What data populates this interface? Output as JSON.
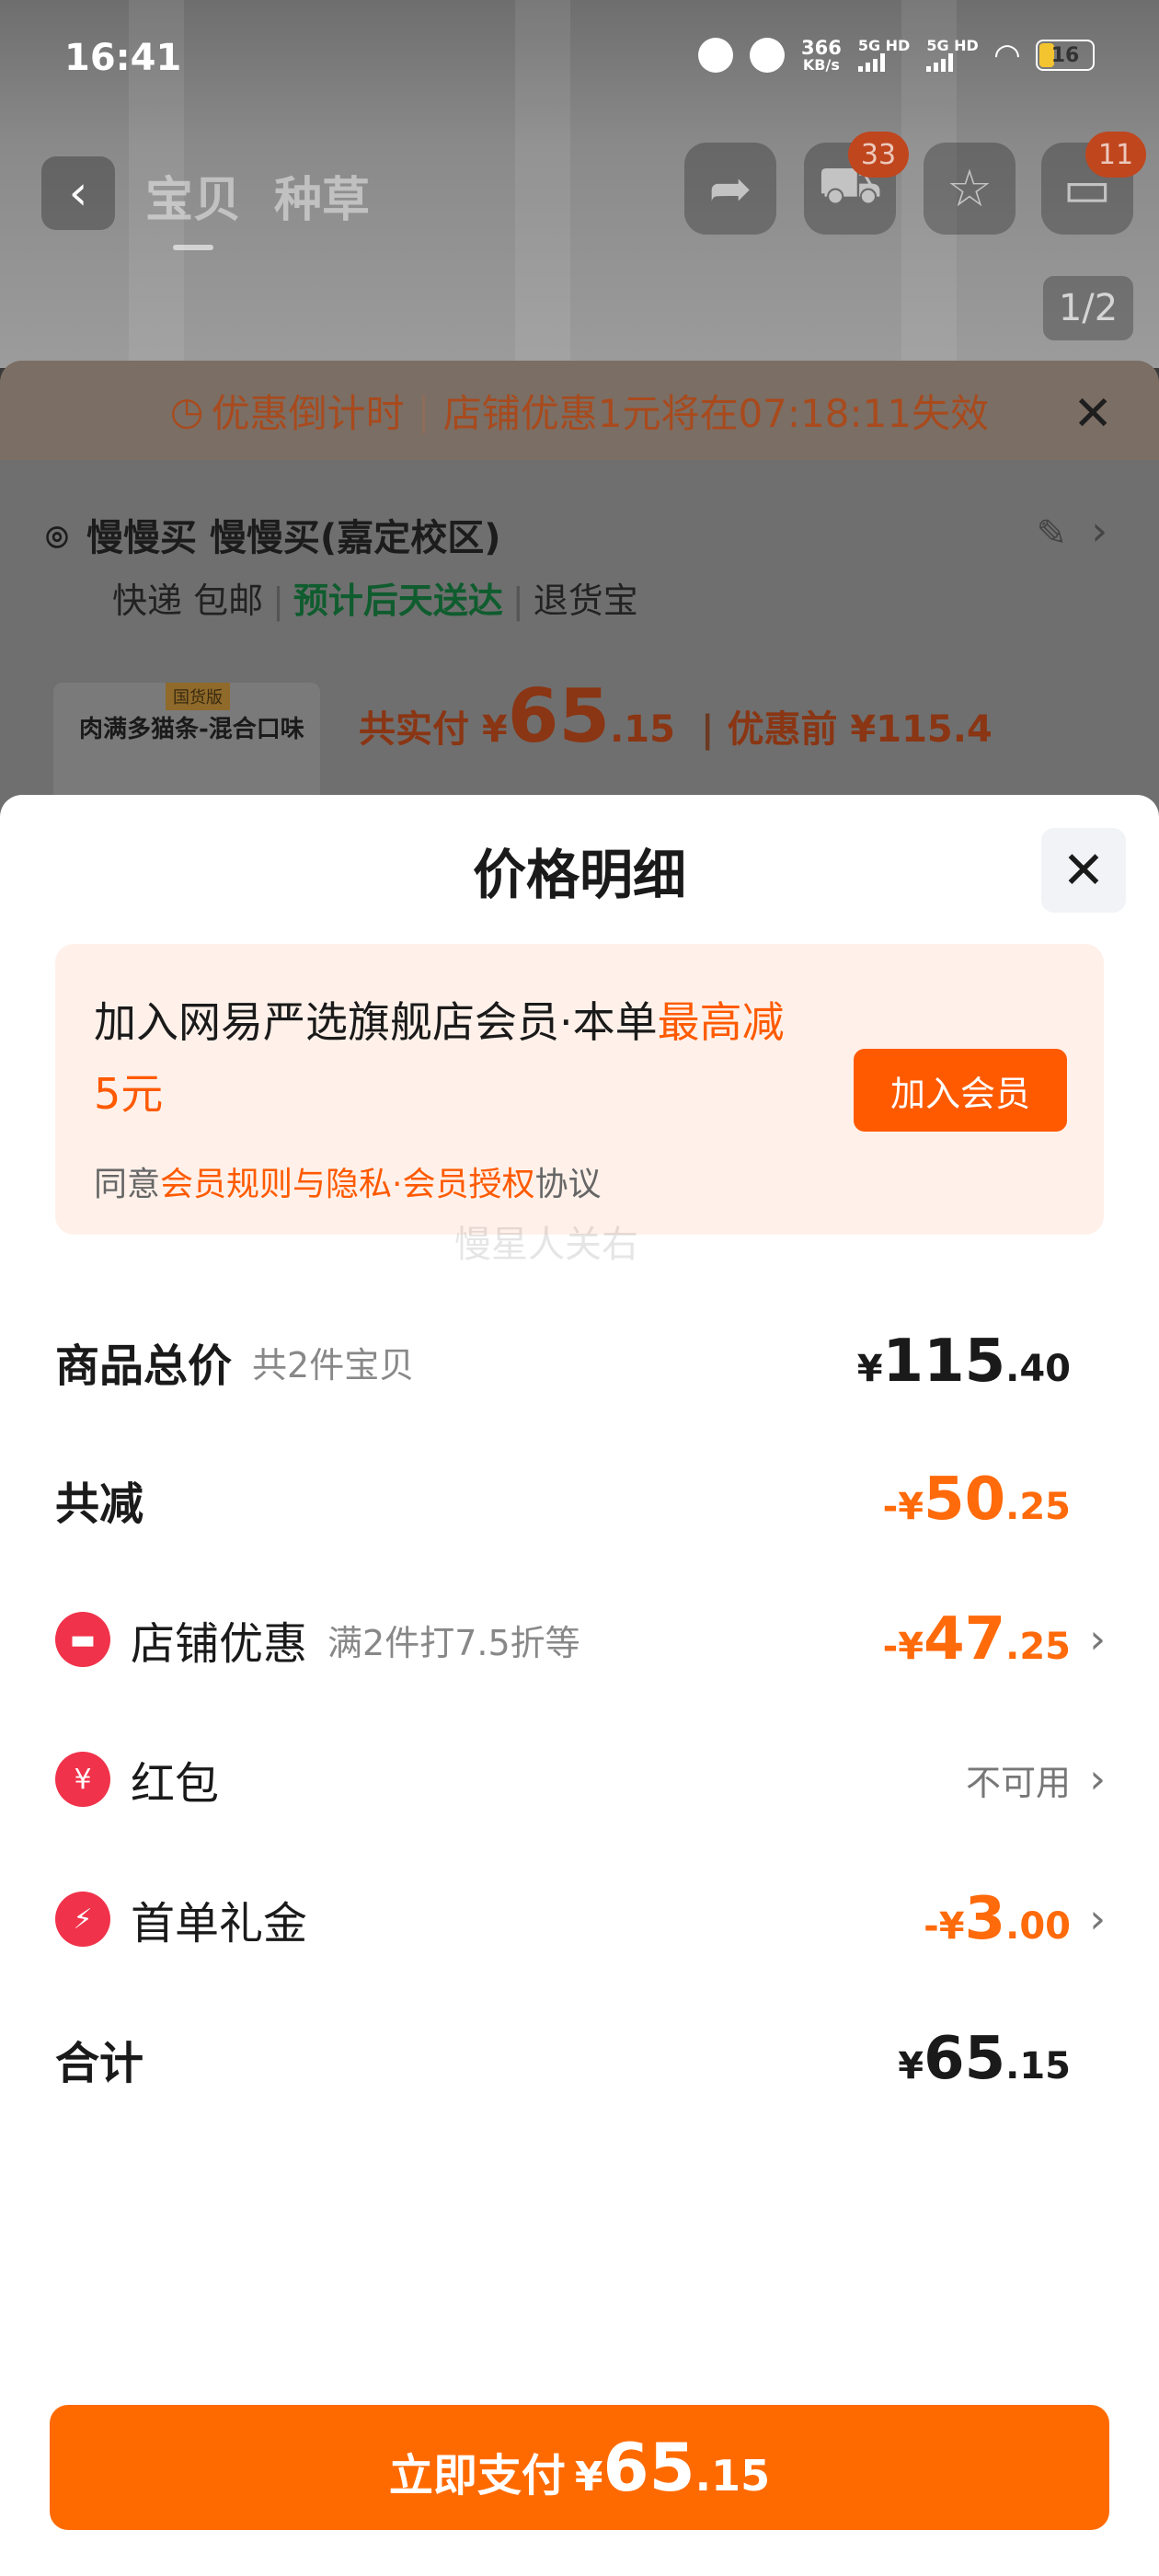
{
  "status": {
    "time": "16:41",
    "speed_value": "366",
    "speed_unit": "KB/s",
    "sim1": "5G HD",
    "sim2": "5G HD",
    "battery": "16"
  },
  "nav": {
    "tab_baobei": "宝贝",
    "tab_zhongcao": "种草",
    "cart_badge": "33",
    "msg_badge": "11",
    "image_counter": "1/2"
  },
  "background": {
    "countdown_label": "优惠倒计时",
    "countdown_text": "店铺优惠1元将在07:18:11失效",
    "address": "慢慢买 慢慢买(嘉定校区)",
    "delivery": "快递 包邮",
    "eta": "预计后天送达",
    "returns": "退货宝",
    "product_tag": "国货版",
    "product_name": "肉满多猫条-混合口味",
    "price_prefix": "共实付 ¥",
    "price_int": "65",
    "price_dec": ".15",
    "price_before": "优惠前 ¥115.4"
  },
  "sheet": {
    "title": "价格明细",
    "watermark": "慢星人关右",
    "member": {
      "text_main": "加入网易严选旗舰店会员·本单",
      "text_highlight": "最高减5元",
      "button": "加入会员",
      "agree_prefix": "同意",
      "agree_link": "会员规则与隐私·会员授权",
      "agree_suffix": "协议"
    },
    "rows": {
      "total": {
        "label": "商品总价",
        "sub": "共2件宝贝",
        "cur": "¥",
        "int": "115",
        "dec": ".40"
      },
      "reduce": {
        "label": "共减",
        "cur": "-¥",
        "int": "50",
        "dec": ".25"
      },
      "shop": {
        "label": "店铺优惠",
        "sub": "满2件打7.5折等",
        "cur": "-¥",
        "int": "47",
        "dec": ".25"
      },
      "redpacket": {
        "label": "红包",
        "value": "不可用"
      },
      "firstorder": {
        "label": "首单礼金",
        "cur": "-¥",
        "int": "3",
        "dec": ".00"
      },
      "sum": {
        "label": "合计",
        "cur": "¥",
        "int": "65",
        "dec": ".15"
      }
    },
    "pay": {
      "label": "立即支付",
      "cur": "¥",
      "int": "65",
      "dec": ".15"
    }
  },
  "colors": {
    "accent": "#ff6a00",
    "discount": "#ff6a0a",
    "icon_red": "#f0324a",
    "member_bg": "#fff1ea"
  }
}
